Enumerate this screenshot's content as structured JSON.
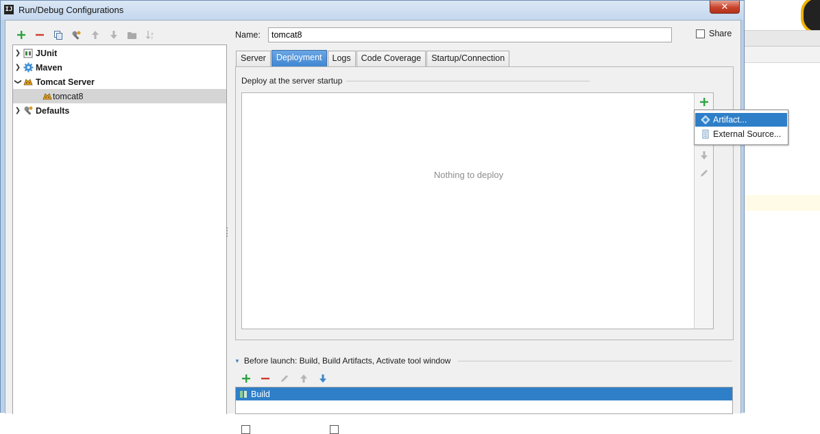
{
  "window": {
    "title": "Run/Debug Configurations",
    "close_label": "✕"
  },
  "colors": {
    "selection_blue": "#2f7fc8",
    "tab_active": "#3f86d2",
    "add_green": "#2aa33e",
    "remove_red": "#d03a2a"
  },
  "toolbar": {
    "icons": [
      "add-icon",
      "remove-icon",
      "copy-icon",
      "wrench-icon",
      "move-up-icon",
      "move-down-icon",
      "folder-icon",
      "sort-icon"
    ]
  },
  "tree": {
    "items": [
      {
        "label": "JUnit",
        "icon": "junit-icon",
        "expanded": false
      },
      {
        "label": "Maven",
        "icon": "maven-gear-icon",
        "expanded": false
      },
      {
        "label": "Tomcat Server",
        "icon": "tomcat-icon",
        "expanded": true
      },
      {
        "label": "tomcat8",
        "icon": "tomcat-icon",
        "selected": true
      },
      {
        "label": "Defaults",
        "icon": "defaults-wrench-icon",
        "expanded": false
      }
    ]
  },
  "config": {
    "name_label": "Name:",
    "name_value": "tomcat8",
    "share_label": "Share"
  },
  "tabs": [
    {
      "label": "Server"
    },
    {
      "label": "Deployment",
      "active": true
    },
    {
      "label": "Logs"
    },
    {
      "label": "Code Coverage"
    },
    {
      "label": "Startup/Connection"
    }
  ],
  "deployment": {
    "group_title": "Deploy at the server startup",
    "empty_text": "Nothing to deploy"
  },
  "popup": {
    "items": [
      {
        "label": "Artifact...",
        "icon": "artifact-icon",
        "selected": true
      },
      {
        "label": "External Source...",
        "icon": "external-source-icon"
      }
    ]
  },
  "before_launch": {
    "title": "Before launch: Build, Build Artifacts, Activate tool window",
    "items": [
      {
        "label": "Build",
        "selected": true
      }
    ]
  }
}
